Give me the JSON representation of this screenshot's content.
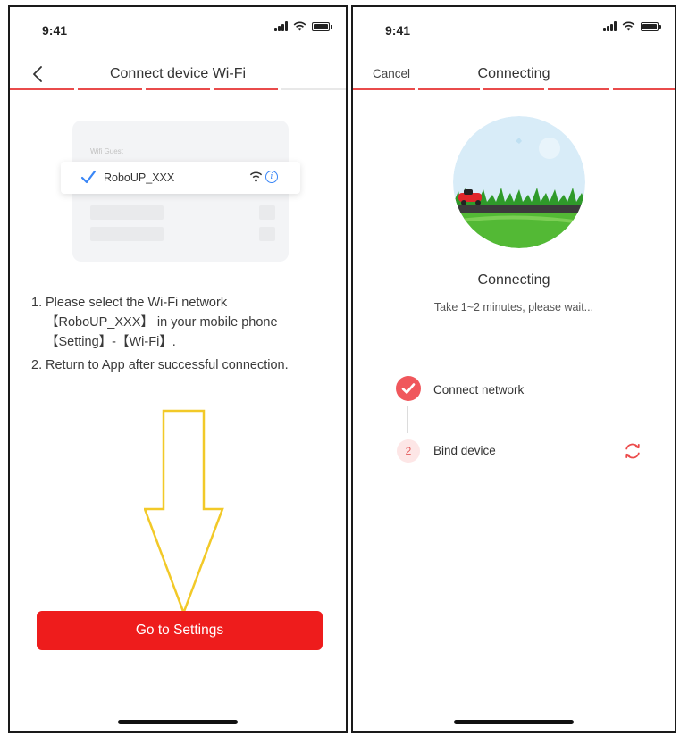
{
  "left_screen": {
    "status": {
      "time": "9:41"
    },
    "header": {
      "title": "Connect device Wi-Fi",
      "back_icon": "chevron-left-icon"
    },
    "progress": {
      "steps_total": 5,
      "steps_active": 4,
      "color": "#e94b4b"
    },
    "wifi_illustration": {
      "list_header": "Wifi Guest",
      "network_name": "RoboUP_XXX",
      "check_icon": "checkmark-icon",
      "signal_icon": "wifi-icon",
      "info_icon": "info-icon",
      "info_glyph": "i"
    },
    "instructions": [
      {
        "num": "1.",
        "text": "Please select the Wi-Fi network 【RoboUP_XXX】 in your mobile phone【Setting】-【Wi-Fi】."
      },
      {
        "num": "2.",
        "text": "Return to App after successful connection."
      }
    ],
    "guide_arrow_icon": "arrow-down-icon",
    "primary_button": {
      "label": "Go to Settings",
      "color": "#ee1c1c"
    }
  },
  "right_screen": {
    "status": {
      "time": "9:41"
    },
    "header": {
      "title": "Connecting",
      "cancel_label": "Cancel"
    },
    "progress": {
      "steps_total": 5,
      "steps_active": 5,
      "color": "#e94b4b"
    },
    "status_title": "Connecting",
    "status_subtitle": "Take 1~2 minutes, please wait...",
    "steps": [
      {
        "label": "Connect network",
        "state": "done",
        "icon": "check-circle-icon"
      },
      {
        "label": "Bind device",
        "state": "in-progress",
        "number": "2",
        "icon": "refresh-icon"
      }
    ]
  }
}
